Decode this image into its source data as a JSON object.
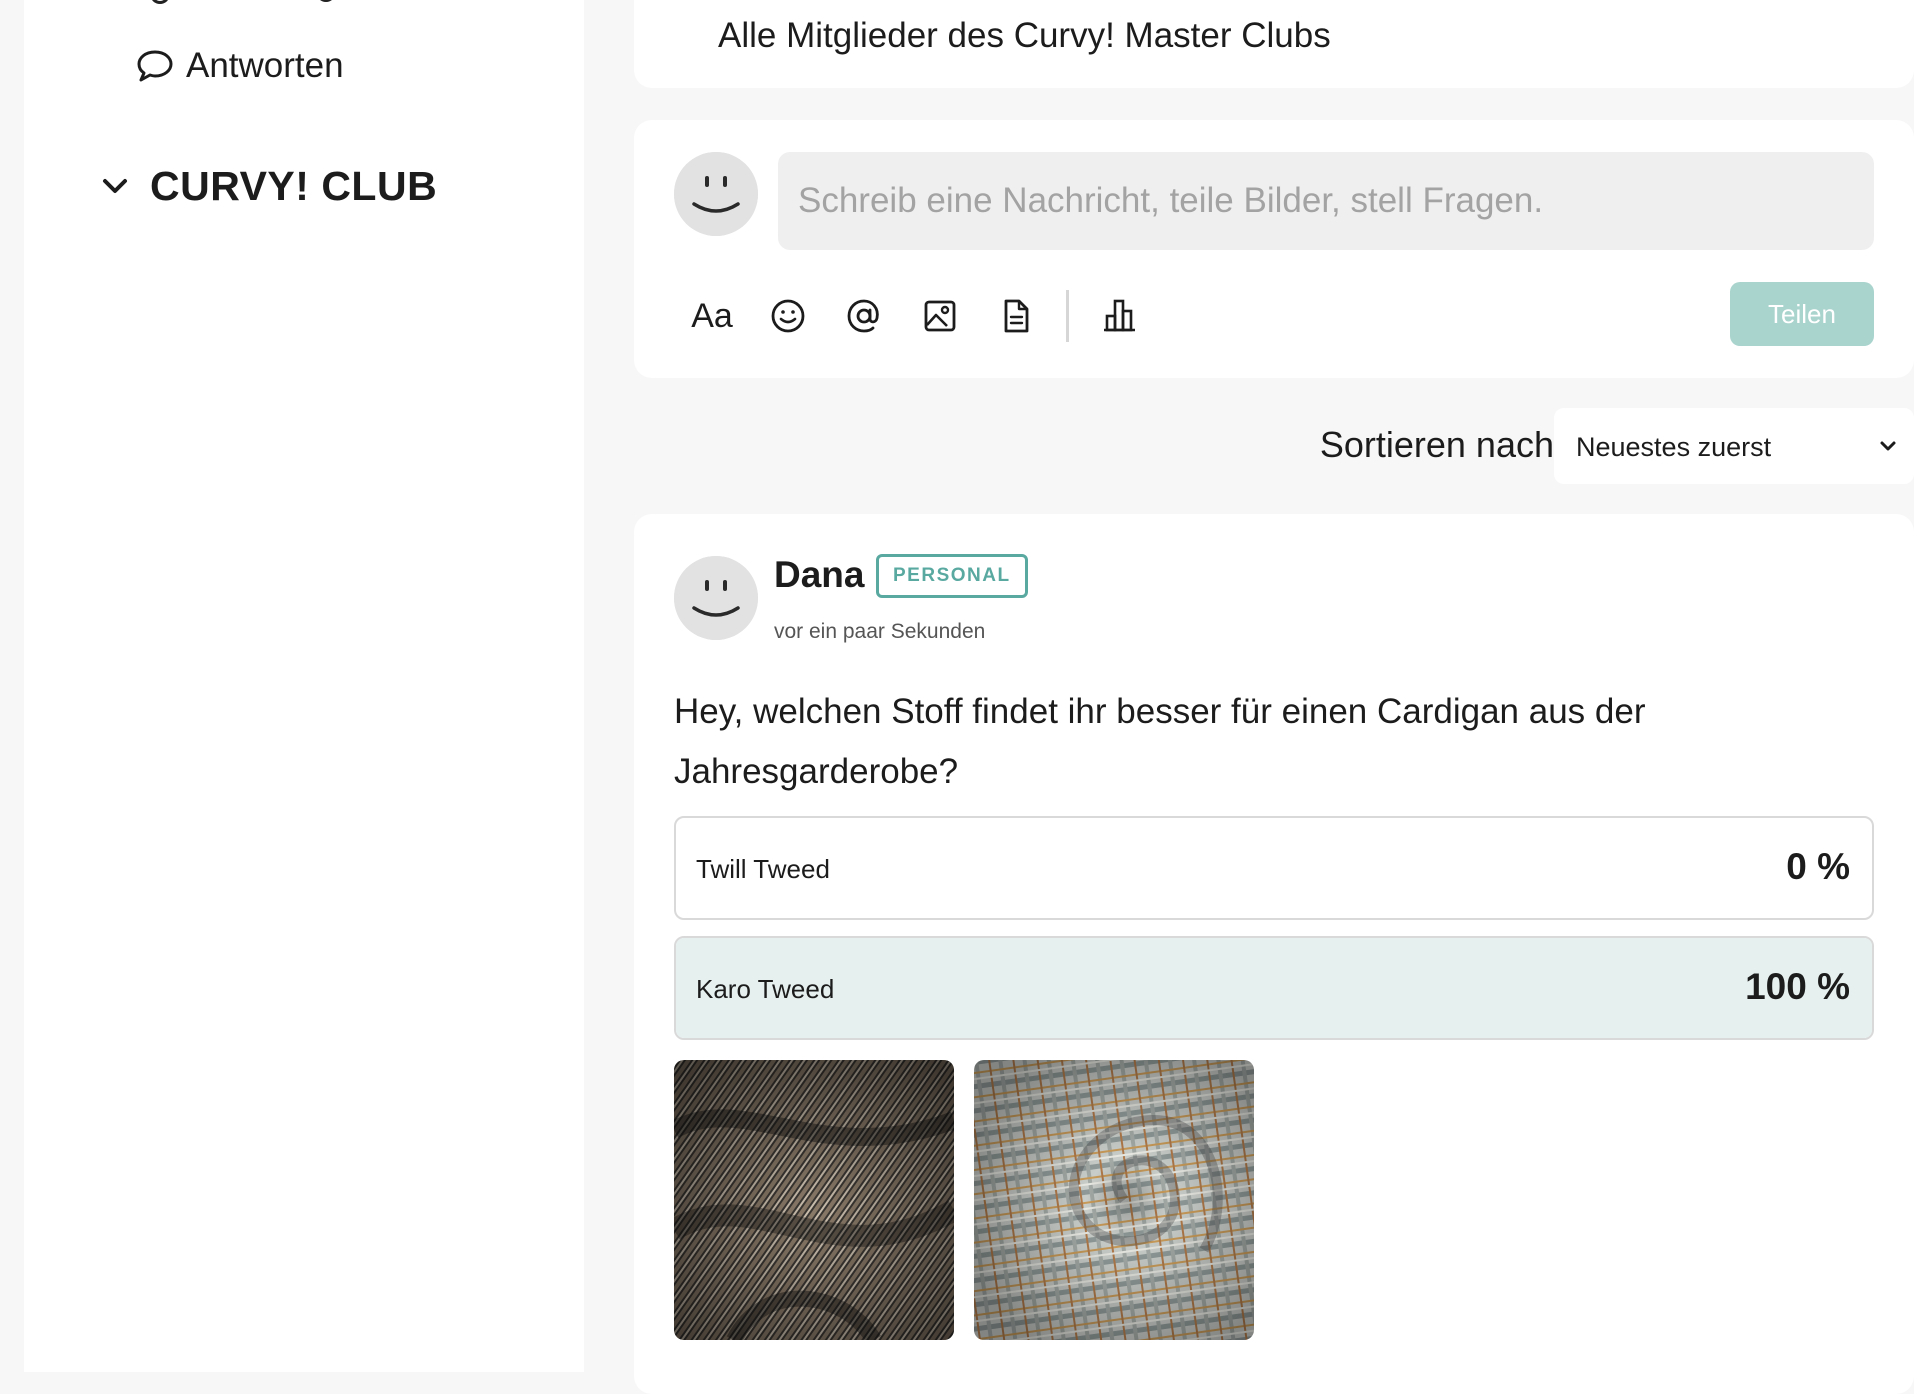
{
  "sidebar": {
    "reply_label": "Antworten",
    "club_title": "CURVY! CLUB"
  },
  "top_card": {
    "text": "Alle Mitglieder des Curvy! Master Clubs"
  },
  "composer": {
    "placeholder": "Schreib eine Nachricht, teile Bilder, stell Fragen.",
    "format_label": "Aa",
    "tools": [
      "text-format",
      "emoji",
      "mention",
      "image",
      "document",
      "poll"
    ],
    "share_label": "Teilen"
  },
  "sort": {
    "label": "Sortieren nach",
    "selected": "Neuestes zuerst"
  },
  "post": {
    "author": "Dana",
    "badge": "PERSONAL",
    "time": "vor ein paar Sekunden",
    "text": "Hey, welchen Stoff findet ihr besser für einen Cardigan aus der Jahresgarderobe?",
    "poll": [
      {
        "label": "Twill Tweed",
        "percent_text": "0 %",
        "fraction": 0.0
      },
      {
        "label": "Karo Tweed",
        "percent_text": "100 %",
        "fraction": 1.0
      }
    ]
  },
  "colors": {
    "accent": "#5aa9a1",
    "share_button": "#a9d3cd",
    "poll_fill": "#e6f0ef",
    "input_bg": "#efefef"
  }
}
